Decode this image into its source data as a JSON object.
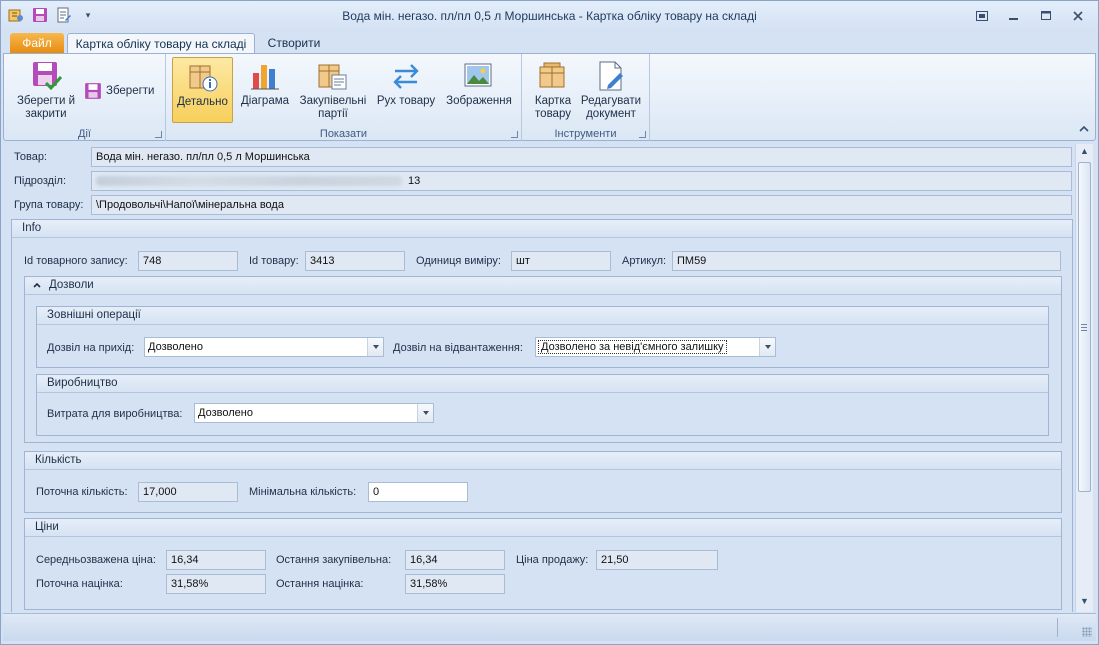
{
  "window": {
    "title": "Вода мін. негазо. пл/пл 0,5 л Моршинська - Картка обліку товару на складі"
  },
  "ribbon": {
    "tabs": {
      "file": "Файл",
      "card": "Картка обліку товару на складі",
      "create": "Створити"
    },
    "groups": {
      "actions": {
        "label": "Дії",
        "save_close": "Зберегти й закрити",
        "save": "Зберегти"
      },
      "show": {
        "label": "Показати",
        "details": "Детально",
        "diagram": "Діаграма",
        "purchase_batches": "Закупівельні партії",
        "movement": "Рух товару",
        "image": "Зображення"
      },
      "tools": {
        "label": "Інструменти",
        "product_card": "Картка товару",
        "edit_document": "Редагувати документ"
      }
    }
  },
  "form": {
    "product_label": "Товар:",
    "product_value": "Вода мін. негазо. пл/пл 0,5 л Моршинська",
    "division_label": "Підрозділ:",
    "division_suffix": "13",
    "group_label": "Група товару:",
    "group_value": "\\Продовольчі\\Напої\\мінеральна вода"
  },
  "info": {
    "title": "Info",
    "record_id_label": "Id товарного запису:",
    "record_id": "748",
    "product_id_label": "Id товару:",
    "product_id": "3413",
    "unit_label": "Одиниця виміру:",
    "unit": "шт",
    "article_label": "Артикул:",
    "article": "ПМ59"
  },
  "permissions": {
    "title": "Дозволи",
    "external": {
      "title": "Зовнішні операції",
      "incoming_label": "Дозвіл на прихід:",
      "incoming_value": "Дозволено",
      "shipment_label": "Дозвіл на відвантаження:",
      "shipment_value": "Дозволено за невід'ємного залишку"
    },
    "production": {
      "title": "Виробництво",
      "consumption_label": "Витрата для виробництва:",
      "consumption_value": "Дозволено"
    }
  },
  "quantity": {
    "title": "Кількість",
    "current_label": "Поточна кількість:",
    "current_value": "17,000",
    "min_label": "Мінімальна кількість:",
    "min_value": "0"
  },
  "prices": {
    "title": "Ціни",
    "avg_label": "Середньозважена ціна:",
    "avg_value": "16,34",
    "last_purchase_label": "Остання закупівельна:",
    "last_purchase_value": "16,34",
    "sale_label": "Ціна продажу:",
    "sale_value": "21,50",
    "current_markup_label": "Поточна націнка:",
    "current_markup_value": "31,58%",
    "last_markup_label": "Остання націнка:",
    "last_markup_value": "31,58%"
  },
  "colors": {
    "accent_file_tab": "#e68a0e",
    "selected_button": "#f7cf5b",
    "panel_bg": "#d5e2f3"
  }
}
